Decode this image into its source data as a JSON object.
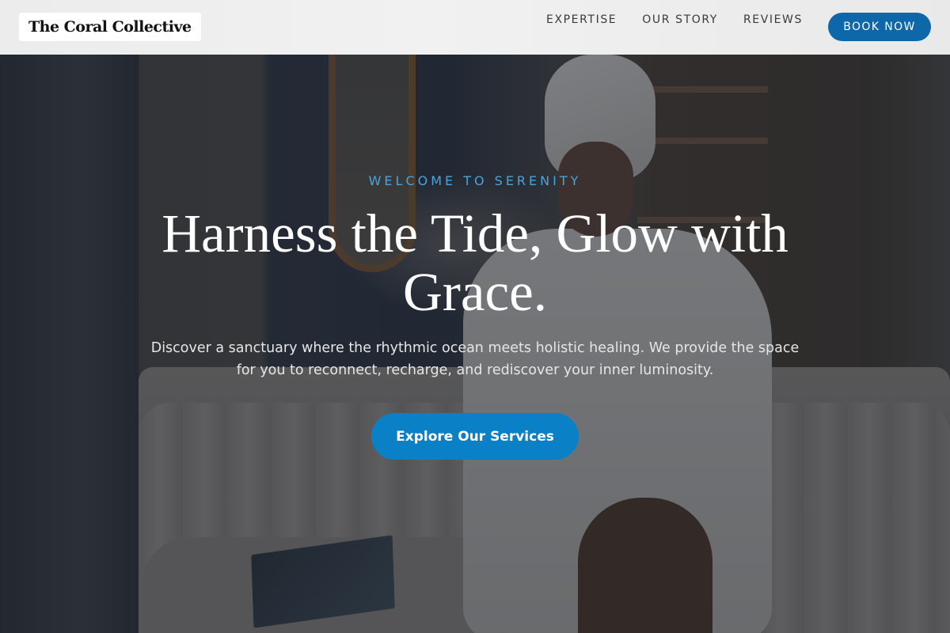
{
  "header": {
    "logo": "The Coral Collective",
    "nav": [
      {
        "label": "EXPERTISE"
      },
      {
        "label": "OUR STORY"
      },
      {
        "label": "REVIEWS"
      }
    ],
    "book_button": "BOOK NOW"
  },
  "hero": {
    "eyebrow": "WELCOME TO SERENITY",
    "headline": "Harness the Tide, Glow with Grace.",
    "subtext": "Discover a sanctuary where the rhythmic ocean meets holistic healing. We provide the space for you to reconnect, recharge, and rediscover your inner luminosity.",
    "cta": "Explore Our Services",
    "background_image": "woman-in-towel-and-robe-spa-photo"
  },
  "colors": {
    "accent": "#0a81c7",
    "book_button": "#0d67a8",
    "eyebrow": "#4aa4d9",
    "header_bg": "#efefef"
  }
}
